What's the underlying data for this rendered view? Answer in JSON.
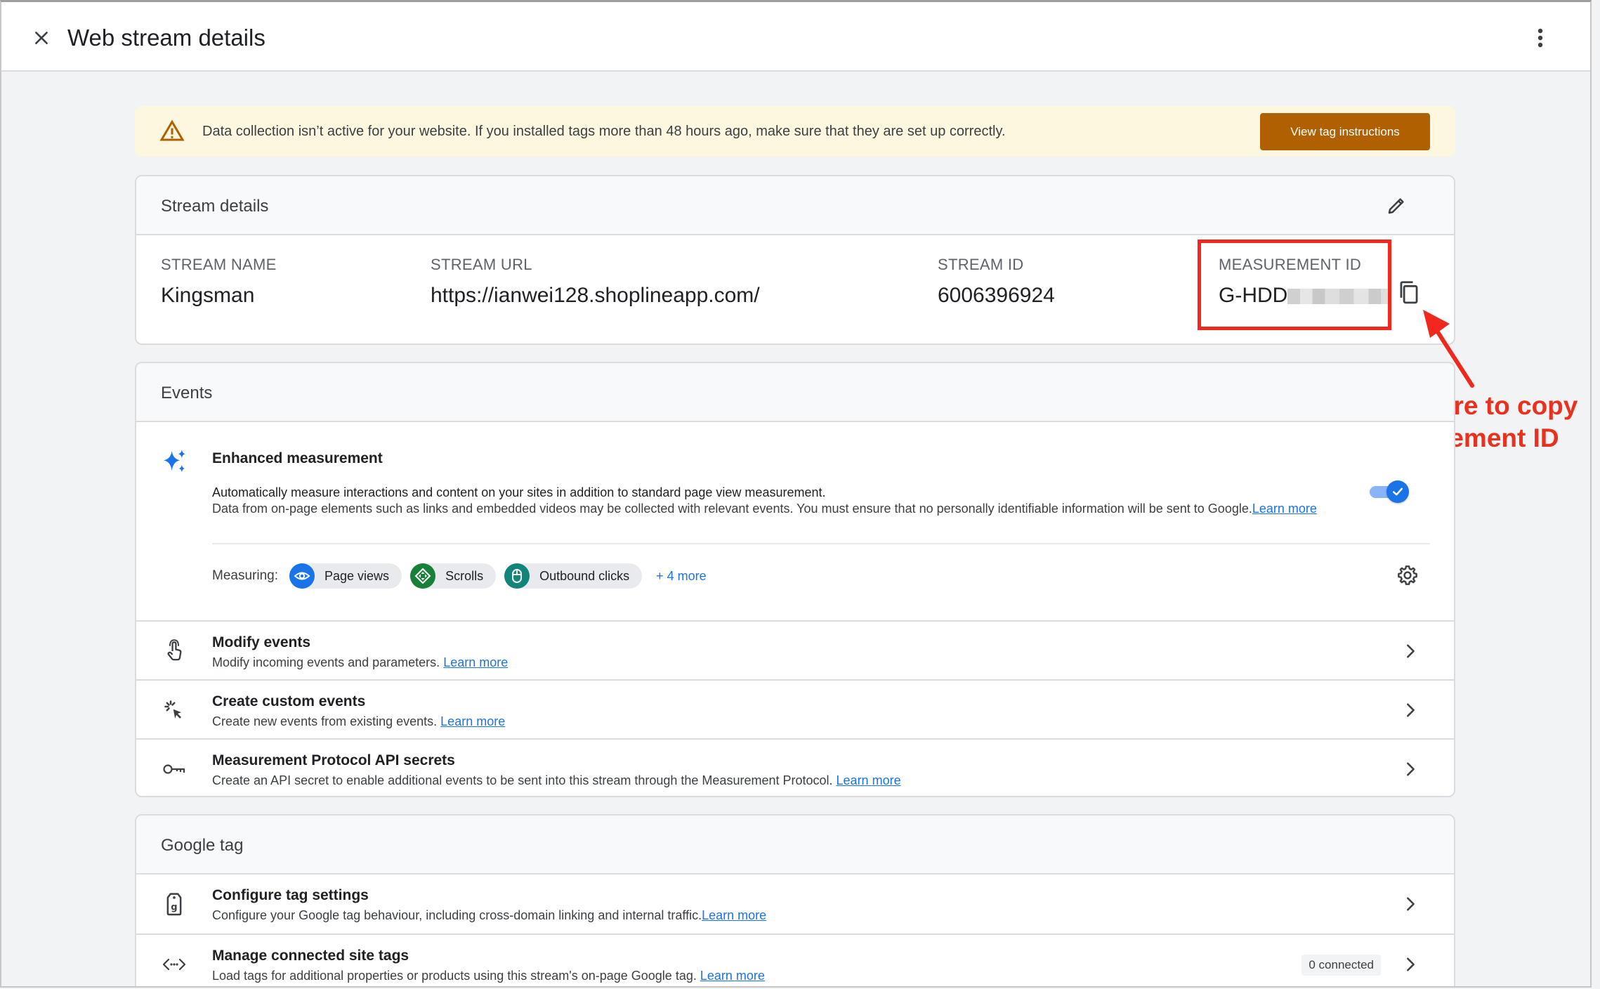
{
  "header": {
    "title": "Web stream details"
  },
  "banner": {
    "message": "Data collection isn’t active for your website. If you installed tags more than 48 hours ago, make sure that they are set up correctly.",
    "button_label": "View tag instructions",
    "accent_color": "#b06000"
  },
  "stream_details": {
    "heading": "Stream details",
    "name_label": "STREAM NAME",
    "name_value": "Kingsman",
    "url_label": "STREAM URL",
    "url_value": "https://ianwei128.shoplineapp.com/",
    "id_label": "STREAM ID",
    "id_value": "6006396924",
    "measurement_label": "MEASUREMENT ID",
    "measurement_value_visible": "G-HDD"
  },
  "annotation": {
    "line1": "Click here to copy",
    "line2": "Mesurement ID",
    "color": "#f2271d"
  },
  "events": {
    "heading": "Events",
    "enhanced": {
      "title": "Enhanced measurement",
      "desc1": "Automatically measure interactions and content on your sites in addition to standard page view measurement.",
      "desc2": "Data from on-page elements such as links and embedded videos may be collected with relevant events. You must ensure that no personally identifiable information will be sent to Google.",
      "learn_more": "Learn more",
      "toggle_on": true,
      "measuring_label": "Measuring:",
      "chips": [
        {
          "label": "Page views",
          "icon": "eye-icon",
          "color": "#1a73e8"
        },
        {
          "label": "Scrolls",
          "icon": "scroll-icon",
          "color": "#188038"
        },
        {
          "label": "Outbound clicks",
          "icon": "mouse-icon",
          "color": "#12857a"
        }
      ],
      "more_label": "+ 4 more"
    },
    "rows": [
      {
        "title": "Modify events",
        "subtitle": "Modify incoming events and parameters.",
        "link": "Learn more"
      },
      {
        "title": "Create custom events",
        "subtitle": "Create new events from existing events.",
        "link": "Learn more"
      },
      {
        "title": "Measurement Protocol API secrets",
        "subtitle": "Create an API secret to enable additional events to be sent into this stream through the Measurement Protocol.",
        "link": "Learn more"
      }
    ]
  },
  "google_tag": {
    "heading": "Google tag",
    "rows": [
      {
        "title": "Configure tag settings",
        "subtitle": "Configure your Google tag behaviour, including cross-domain linking and internal traffic.",
        "link": "Learn more"
      },
      {
        "title": "Manage connected site tags",
        "subtitle": "Load tags for additional properties or products using this stream's on-page Google tag.",
        "link": "Learn more",
        "badge": "0 connected"
      }
    ]
  }
}
